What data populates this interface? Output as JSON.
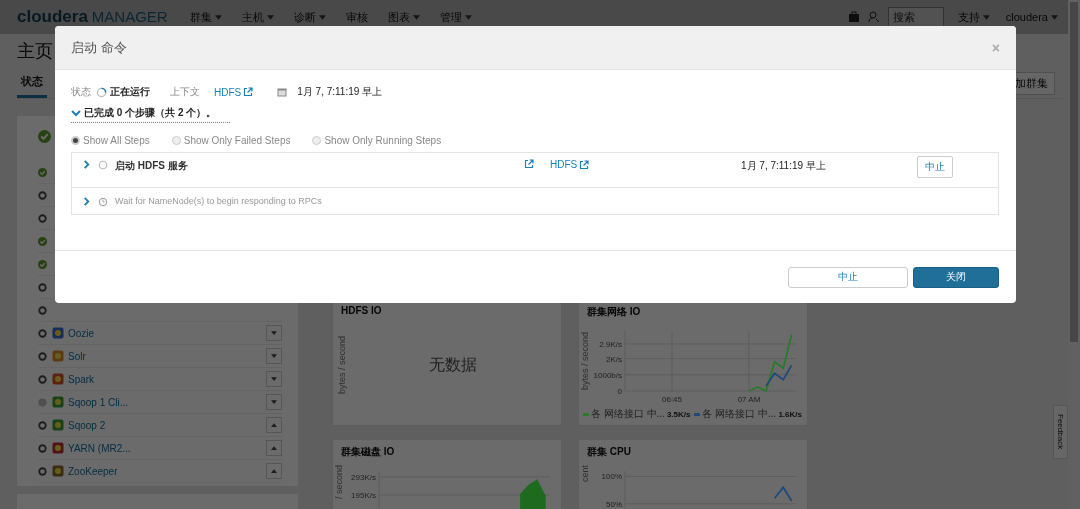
{
  "navbar": {
    "logo_brand": "cloudera",
    "logo_product": "MANAGER",
    "menus": [
      {
        "label": "群集",
        "dropdown": true
      },
      {
        "label": "主机",
        "dropdown": true
      },
      {
        "label": "诊断",
        "dropdown": true
      },
      {
        "label": "审核",
        "dropdown": false
      },
      {
        "label": "图表",
        "dropdown": true
      },
      {
        "label": "管理",
        "dropdown": true
      }
    ],
    "search": {
      "placeholder": "搜索"
    },
    "right_menus": [
      {
        "label": "支持",
        "dropdown": true
      },
      {
        "label": "cloudera",
        "dropdown": true
      }
    ]
  },
  "page": {
    "title": "主页",
    "tabs": [
      {
        "label": "状态",
        "selected": true
      }
    ],
    "add_cluster_button": "加群集"
  },
  "services": {
    "summary_icon": {
      "kind": "good"
    },
    "items": [
      {
        "kind": "good"
      },
      {
        "kind": "stopped"
      },
      {
        "kind": "stopped"
      },
      {
        "kind": "good"
      },
      {
        "kind": "good"
      },
      {
        "kind": "stopped"
      },
      {
        "kind": "stopped"
      },
      {
        "name": "Oozie",
        "kind": "stopped",
        "caret_up": false
      },
      {
        "name": "Solr",
        "kind": "stopped",
        "caret_up": false
      },
      {
        "name": "Spark",
        "kind": "stopped",
        "caret_up": false
      },
      {
        "name": "Sqoop 1 Cli...",
        "kind": "none",
        "caret_up": false
      },
      {
        "name": "Sqoop 2",
        "kind": "stopped",
        "caret_up": true
      },
      {
        "name": "YARN (MR2...",
        "kind": "stopped",
        "caret_up": true
      },
      {
        "name": "ZooKeeper",
        "kind": "stopped",
        "caret_up": true
      }
    ]
  },
  "charts": [
    {
      "title": "HDFS IO",
      "ylabel": "bytes / second",
      "empty_text": "无数据"
    },
    {
      "title": "群集网络 IO",
      "legend_values": [
        "3.5K/s",
        "1.6K/s"
      ],
      "chart_data": {
        "type": "line",
        "ylabel": "bytes / second",
        "categories": [
          null,
          null,
          null,
          null,
          null,
          "06:45",
          null,
          null,
          null,
          null,
          null,
          null,
          null,
          null,
          "07 AM",
          null,
          null,
          null,
          null,
          null
        ],
        "grid": true,
        "ylim": [
          0,
          3700
        ],
        "yticks": [
          {
            "value": 0,
            "label": "0"
          },
          {
            "value": 1000,
            "label": "1000b/s"
          },
          {
            "value": 2000,
            "label": "2K/s"
          },
          {
            "value": 2900,
            "label": "2.9K/s"
          }
        ],
        "series": [
          {
            "name": "各 网络接口 中...",
            "color": "#2a7a2a",
            "values": [
              null,
              null,
              null,
              null,
              null,
              null,
              null,
              null,
              null,
              null,
              null,
              null,
              null,
              null,
              0,
              250,
              0,
              1800,
              1400,
              3500
            ]
          },
          {
            "name": "各 网络接口 中...",
            "color": "#1f4a7a",
            "values": [
              null,
              null,
              null,
              null,
              null,
              null,
              null,
              null,
              null,
              null,
              null,
              null,
              null,
              null,
              null,
              null,
              300,
              1100,
              700,
              1600
            ]
          }
        ]
      }
    },
    {
      "title": "群集磁盘 IO",
      "chart_data": {
        "type": "area",
        "ylabel": "/ second",
        "categories": [
          null,
          null,
          null,
          null,
          null,
          null,
          null,
          null,
          null,
          null,
          null,
          null,
          null,
          null,
          null,
          null,
          null,
          null,
          null,
          null
        ],
        "grid": true,
        "ylim": [
          0,
          325000
        ],
        "yticks": [
          {
            "value": 195000,
            "label": "195K/s"
          },
          {
            "value": 293000,
            "label": "293K/s"
          }
        ],
        "series": [
          {
            "color": "#1e6a1e",
            "values": [
              null,
              null,
              null,
              null,
              null,
              null,
              null,
              null,
              null,
              null,
              null,
              null,
              null,
              null,
              null,
              null,
              200000,
              250000,
              280000,
              190000
            ]
          }
        ]
      }
    },
    {
      "title": "群集 CPU",
      "chart_data": {
        "type": "line",
        "ylabel": "cent",
        "categories": [
          null,
          null,
          null,
          null,
          null,
          null,
          null,
          null,
          null,
          null,
          null,
          null,
          null,
          null,
          null,
          null,
          null,
          null,
          null,
          null
        ],
        "grid": true,
        "ylim": [
          0,
          110
        ],
        "yticks": [
          {
            "value": 50,
            "label": "50%"
          },
          {
            "value": 100,
            "label": "100%"
          }
        ],
        "series": [
          {
            "color": "#1f4a7a",
            "values": [
              null,
              null,
              null,
              null,
              null,
              null,
              null,
              null,
              null,
              null,
              null,
              null,
              null,
              null,
              null,
              null,
              null,
              60,
              80,
              55
            ]
          }
        ]
      }
    }
  ],
  "modal": {
    "title": "启动 命令",
    "close": "×",
    "status_label": "状态",
    "status": "正在运行",
    "running": true,
    "context_label": "上下文",
    "context_link": "HDFS",
    "time": "1月 7, 7:11:19 早上",
    "summary": "已完成 0 个步骤（共 2 个）。",
    "expanded": true,
    "filters": [
      {
        "label": "Show All Steps",
        "selected": true
      },
      {
        "label": "Show Only Failed Steps",
        "selected": false
      },
      {
        "label": "Show Only Running Steps",
        "selected": false
      }
    ],
    "steps": [
      {
        "kind": "running",
        "name": "启动 HDFS 服务",
        "link": "HDFS",
        "time": "1月 7, 7:11:19 早上",
        "action": "中止",
        "expanded": false
      },
      {
        "kind": "pending",
        "name": "Wait for NameNode(s) to begin responding to RPCs",
        "expanded": false
      }
    ],
    "buttons": [
      {
        "label": "中止",
        "primary": false
      },
      {
        "label": "关闭",
        "primary": true
      }
    ]
  },
  "feedback": "Feedback"
}
